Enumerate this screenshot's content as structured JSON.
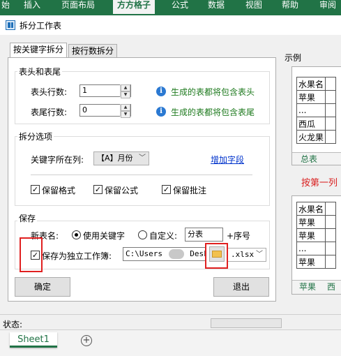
{
  "ribbon": {
    "tabs": [
      "始",
      "插入",
      "页面布局",
      "方方格子",
      "公式",
      "数据",
      "视图",
      "帮助",
      "审阅"
    ],
    "active": "方方格子"
  },
  "dialog": {
    "title": "拆分工作表",
    "tabs": [
      "按关键字拆分",
      "按行数拆分"
    ],
    "header_footer": {
      "group_title": "表头和表尾",
      "header_rows_label": "表头行数:",
      "header_rows_value": "1",
      "header_hint": "生成的表都将包含表头",
      "footer_rows_label": "表尾行数:",
      "footer_rows_value": "0",
      "footer_hint": "生成的表都将包含表尾"
    },
    "split_options": {
      "group_title": "拆分选项",
      "key_col_label": "关键字所在列:",
      "key_col_value": "【A】月份",
      "add_field_link": "增加字段",
      "keep_format": "保留格式",
      "keep_formula": "保留公式",
      "keep_comment": "保留批注"
    },
    "save": {
      "group_title": "保存",
      "new_name_label": "新表名:",
      "use_keyword": "使用关键字",
      "custom": "自定义:",
      "custom_value": "分表",
      "seq_suffix": "+序号",
      "save_separate": "保存为独立工作簿:",
      "path_value": "C:\\Users",
      "path_tail": "Deskt",
      "ext_value": ".xlsx"
    },
    "ok_button": "确定",
    "exit_button": "退出",
    "preview": {
      "label": "示例",
      "top_header": "水果名",
      "top_rows": [
        "苹果",
        "...",
        "西瓜",
        "火龙果"
      ],
      "top_tabs": [
        "总表"
      ],
      "arrow_text": "按第一列",
      "bottom_header": "水果名",
      "bottom_rows": [
        "苹果",
        "苹果",
        "...",
        "苹果"
      ],
      "bottom_tabs": [
        "苹果",
        "西"
      ]
    }
  },
  "status": {
    "label": "状态:"
  },
  "excel": {
    "sheet_tab": "Sheet1"
  },
  "colors": {
    "ribbon": "#217346",
    "highlight": "#e02020",
    "hint_text": "#1e7a1e",
    "link": "#0033cc"
  }
}
